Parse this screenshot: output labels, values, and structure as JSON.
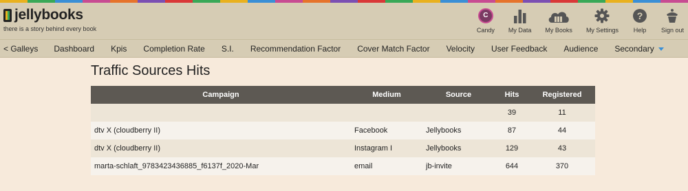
{
  "colors": {
    "rainbow": [
      "#e9b11e",
      "#39a857",
      "#3a8fd6",
      "#c84b92",
      "#e6732b",
      "#7b4fb3",
      "#d93838",
      "#39a857",
      "#e9b11e",
      "#3a8fd6",
      "#c84b92",
      "#e6732b",
      "#7b4fb3",
      "#d93838",
      "#39a857",
      "#e9b11e",
      "#3a8fd6",
      "#c84b92",
      "#e6732b",
      "#7b4fb3",
      "#d93838",
      "#39a857",
      "#e9b11e",
      "#3a8fd6",
      "#c84b92"
    ],
    "topbar": "#d6ccb4",
    "table_header": "#5d5953",
    "accent": "#3a8fd6"
  },
  "brand": {
    "name": "jellybooks",
    "tagline": "there is a story behind every book"
  },
  "topnav": [
    {
      "label": "Candy",
      "icon": "avatar-c",
      "initial": "C"
    },
    {
      "label": "My Data",
      "icon": "bar-chart-icon"
    },
    {
      "label": "My Books",
      "icon": "cloud-books-icon"
    },
    {
      "label": "My Settings",
      "icon": "gear-icon"
    },
    {
      "label": "Help",
      "icon": "help-icon"
    },
    {
      "label": "Sign out",
      "icon": "sign-out-icon"
    }
  ],
  "menu": [
    "< Galleys",
    "Dashboard",
    "Kpis",
    "Completion Rate",
    "S.I.",
    "Recommendation Factor",
    "Cover Match Factor",
    "Velocity",
    "User Feedback",
    "Audience",
    "Secondary"
  ],
  "page": {
    "title": "Traffic Sources Hits"
  },
  "table": {
    "headers": [
      "Campaign",
      "Medium",
      "Source",
      "Hits",
      "Registered"
    ],
    "rows": [
      [
        "",
        "",
        "",
        "39",
        "11"
      ],
      [
        "dtv X (cloudberry II)",
        "Facebook",
        "Jellybooks",
        "87",
        "44"
      ],
      [
        "dtv X (cloudberry II)",
        "Instagram I",
        "Jellybooks",
        "129",
        "43"
      ],
      [
        "marta-schlaft_9783423436885_f6137f_2020-Mar",
        "email",
        "jb-invite",
        "644",
        "370"
      ]
    ]
  }
}
